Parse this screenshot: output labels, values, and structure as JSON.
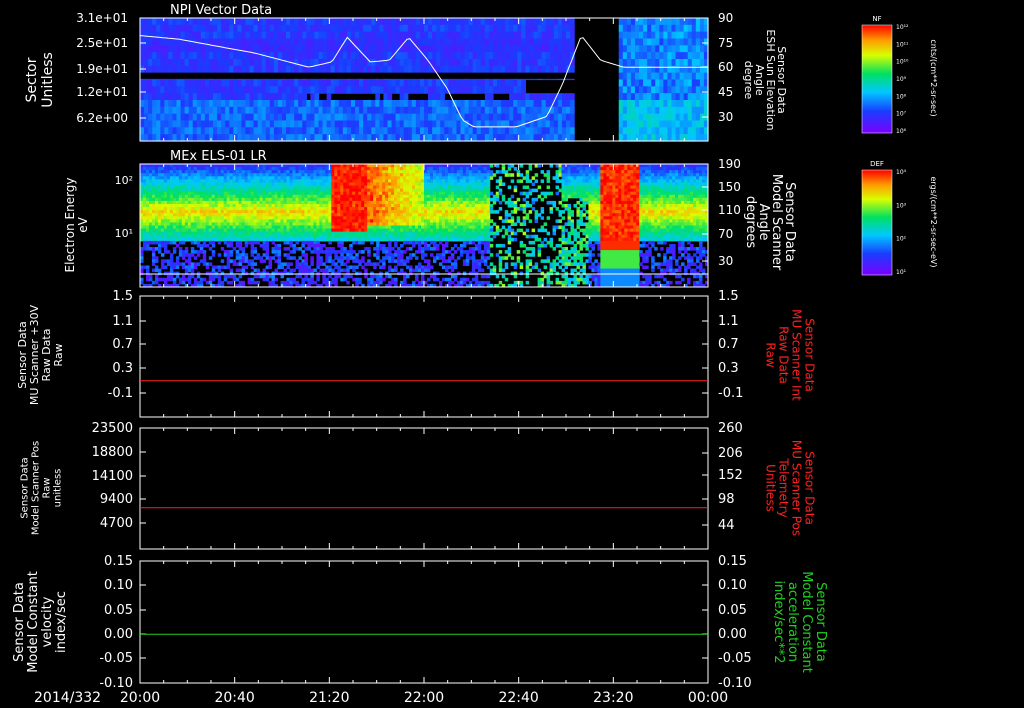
{
  "figure": {
    "date_label": "2014/332",
    "time_ticks": [
      "20:00",
      "20:40",
      "21:20",
      "22:00",
      "22:40",
      "23:20",
      "00:00"
    ]
  },
  "colors": {
    "background": "#000000",
    "axis": "#ffffff",
    "red_trace": "#ff2020",
    "green_trace": "#20d020"
  },
  "chart_data": [
    {
      "type": "heatmap",
      "title": "NPI Vector Data",
      "ylabel": [
        "Sector",
        "Unitless"
      ],
      "yticks": [
        "3.1e+01",
        "2.5e+01",
        "1.9e+01",
        "1.2e+01",
        "6.2e+00"
      ],
      "right_label": [
        "Sensor Data",
        "ESH Sun Elevation",
        "Angle",
        "degree"
      ],
      "right_ticks": [
        "90",
        "75",
        "60",
        "45",
        "30"
      ],
      "right_ylim": [
        20,
        90
      ],
      "overlay_series": {
        "name": "ESH Sun Elevation Angle",
        "x_hours": [
          0,
          0.5,
          1.0,
          1.5,
          2.2,
          2.5,
          2.7,
          3.0,
          3.25,
          3.5,
          3.75,
          4.0,
          4.2,
          4.35,
          4.6,
          4.9,
          5.3,
          5.5,
          5.75,
          6.0,
          6.3,
          6.6,
          7.0,
          7.4
        ],
        "values": [
          80,
          78,
          74,
          70,
          62,
          65,
          79,
          65,
          66,
          79,
          66,
          50,
          32,
          28,
          28,
          28,
          34,
          52,
          80,
          66,
          62,
          62,
          62,
          62
        ]
      },
      "colorbar": {
        "title": "NF",
        "ticks": [
          "10¹²",
          "10¹¹",
          "10¹⁰",
          "10⁹",
          "10⁸",
          "10⁷",
          "10⁶"
        ],
        "unit": "cnts/(cm**2-sr-sec)"
      }
    },
    {
      "type": "heatmap",
      "title": "MEx ELS-01 LR",
      "ylabel": [
        "Electron Energy",
        "eV"
      ],
      "yticks": [
        "10²",
        "10¹"
      ],
      "right_label": [
        "Sensor Data",
        "Model Scanner",
        "Angle",
        "degrees"
      ],
      "right_ticks": [
        "190",
        "150",
        "110",
        "70",
        "30"
      ],
      "colorbar": {
        "title": "DEF",
        "ticks": [
          "10⁴",
          "10³",
          "10²",
          "10¹"
        ],
        "unit": "ergs/(cm**2-sr-sec-eV)"
      }
    },
    {
      "type": "line",
      "ylabel": [
        "Sensor Data",
        "MU Scanner +30V",
        "Raw Data",
        "Raw"
      ],
      "yticks": [
        "1.5",
        "1.1",
        "0.7",
        "0.3",
        "-0.1"
      ],
      "ylim": [
        -0.5,
        1.5
      ],
      "right_label": [
        "Sensor Data",
        "MU Scanner Int",
        "Raw Data",
        "Raw"
      ],
      "right_ticks": [
        "1.5",
        "1.1",
        "0.7",
        "0.3",
        "-0.1"
      ],
      "series": [
        {
          "values": [
            0.1,
            0.1
          ],
          "color": "#ff2020"
        }
      ]
    },
    {
      "type": "line",
      "ylabel": [
        "Sensor Data",
        "Model Scanner Pos",
        "Raw",
        "unitless"
      ],
      "yticks": [
        "23500",
        "18800",
        "14100",
        "9400",
        "4700"
      ],
      "ylim": [
        0,
        23500
      ],
      "right_label": [
        "Sensor Data",
        "MU Scanner Pos",
        "Telemetry",
        "Unitless"
      ],
      "right_ticks": [
        "260",
        "206",
        "152",
        "98",
        "44"
      ],
      "series": [
        {
          "values": [
            8000,
            8000
          ],
          "color": "#ff2020"
        }
      ]
    },
    {
      "type": "line",
      "ylabel": [
        "Sensor Data",
        "Model Constant",
        "velocity",
        "index/sec"
      ],
      "yticks": [
        "0.15",
        "0.10",
        "0.05",
        "0.00",
        "-0.05",
        "-0.10"
      ],
      "ylim": [
        -0.1,
        0.15
      ],
      "right_label": [
        "Sensor Data",
        "Model Constant",
        "acceleration",
        "index/sec**2"
      ],
      "right_ticks": [
        "0.15",
        "0.10",
        "0.05",
        "0.00",
        "-0.05",
        "-0.10"
      ],
      "series": [
        {
          "values": [
            0.0,
            0.0
          ],
          "color": "#20d020"
        }
      ]
    }
  ]
}
